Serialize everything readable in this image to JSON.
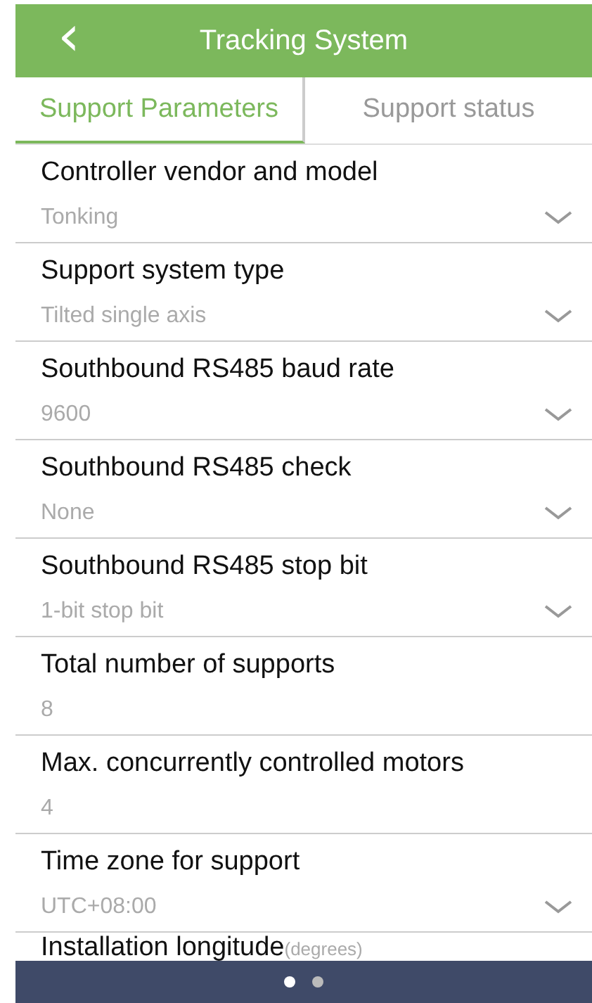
{
  "header": {
    "back": "‹",
    "title": "Tracking System"
  },
  "tabs": [
    {
      "label": "Support Parameters",
      "selected": true
    },
    {
      "label": "Support status",
      "selected": false
    }
  ],
  "fields": [
    {
      "label": "Controller vendor and model",
      "value": "Tonking",
      "kind": "dropdown"
    },
    {
      "label": "Support system type",
      "value": "Tilted single axis",
      "kind": "dropdown"
    },
    {
      "label": "Southbound RS485 baud rate",
      "value": "9600",
      "kind": "dropdown"
    },
    {
      "label": "Southbound RS485 check",
      "value": "None",
      "kind": "dropdown"
    },
    {
      "label": "Southbound RS485 stop bit",
      "value": "1-bit stop bit",
      "kind": "dropdown"
    },
    {
      "label": "Total number of supports",
      "value": "8",
      "kind": "input"
    },
    {
      "label": "Max. concurrently controlled motors",
      "value": "4",
      "kind": "input"
    },
    {
      "label": "Time zone for support",
      "value": "UTC+08:00",
      "kind": "dropdown"
    }
  ],
  "partial_field": {
    "label": "Installation longitude",
    "unit": "(degrees)"
  },
  "pager": [
    {
      "selected": true
    },
    {
      "selected": false
    }
  ]
}
